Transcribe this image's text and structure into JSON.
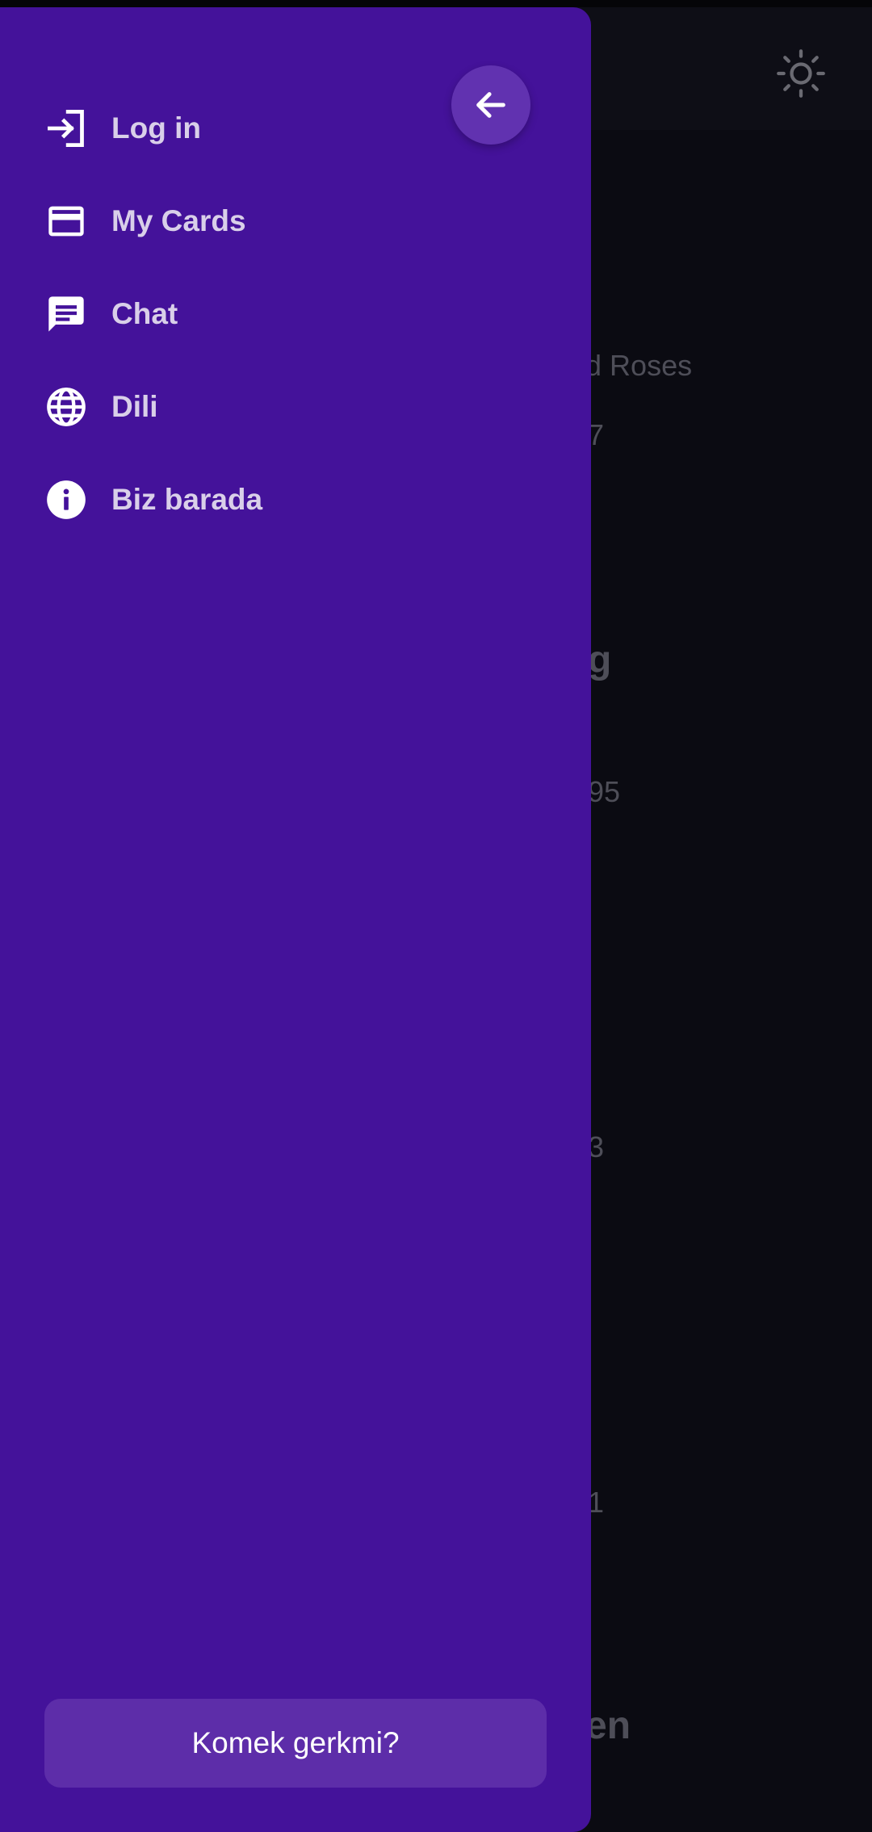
{
  "background": {
    "theme_icon": "sun-icon",
    "fragments": [
      "nd Roses",
      "7",
      "g",
      "95",
      "3",
      "1",
      "en"
    ]
  },
  "drawer": {
    "back_icon": "arrow-left-icon",
    "items": [
      {
        "label": "Log in",
        "icon": "login-icon"
      },
      {
        "label": "My Cards",
        "icon": "credit-card-icon"
      },
      {
        "label": "Chat",
        "icon": "chat-icon"
      },
      {
        "label": "Dili",
        "icon": "globe-icon"
      },
      {
        "label": "Biz barada",
        "icon": "info-icon"
      }
    ],
    "help_label": "Komek gerkmi?"
  },
  "colors": {
    "drawer_bg": "#44129a",
    "accent_button": "#5d2da9",
    "app_bg": "#0b0b12",
    "label_text": "#d9cfe9"
  }
}
